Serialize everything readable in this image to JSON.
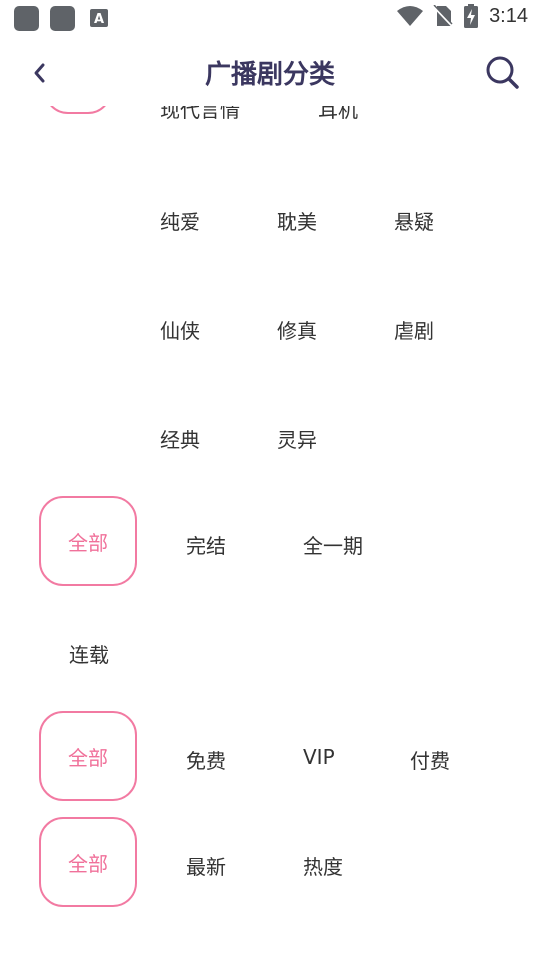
{
  "status_bar": {
    "time": "3:14",
    "a_icon_letter": "A"
  },
  "header": {
    "title": "广播剧分类"
  },
  "genre": {
    "cut_row": [
      "现代言情",
      "耳机"
    ],
    "rows": [
      [
        "纯爱",
        "耽美",
        "悬疑"
      ],
      [
        "仙侠",
        "修真",
        "虐剧"
      ],
      [
        "经典",
        "灵异"
      ]
    ]
  },
  "status_filter": {
    "selected": "全部",
    "options": [
      "完结",
      "全一期",
      "连载"
    ]
  },
  "price_filter": {
    "selected": "全部",
    "options": [
      "免费",
      "VIP",
      "付费"
    ]
  },
  "sort_filter": {
    "selected": "全部",
    "options": [
      "最新",
      "热度"
    ]
  },
  "colors": {
    "accent": "#f27aa2",
    "title": "#3b3760",
    "text": "#333333"
  }
}
